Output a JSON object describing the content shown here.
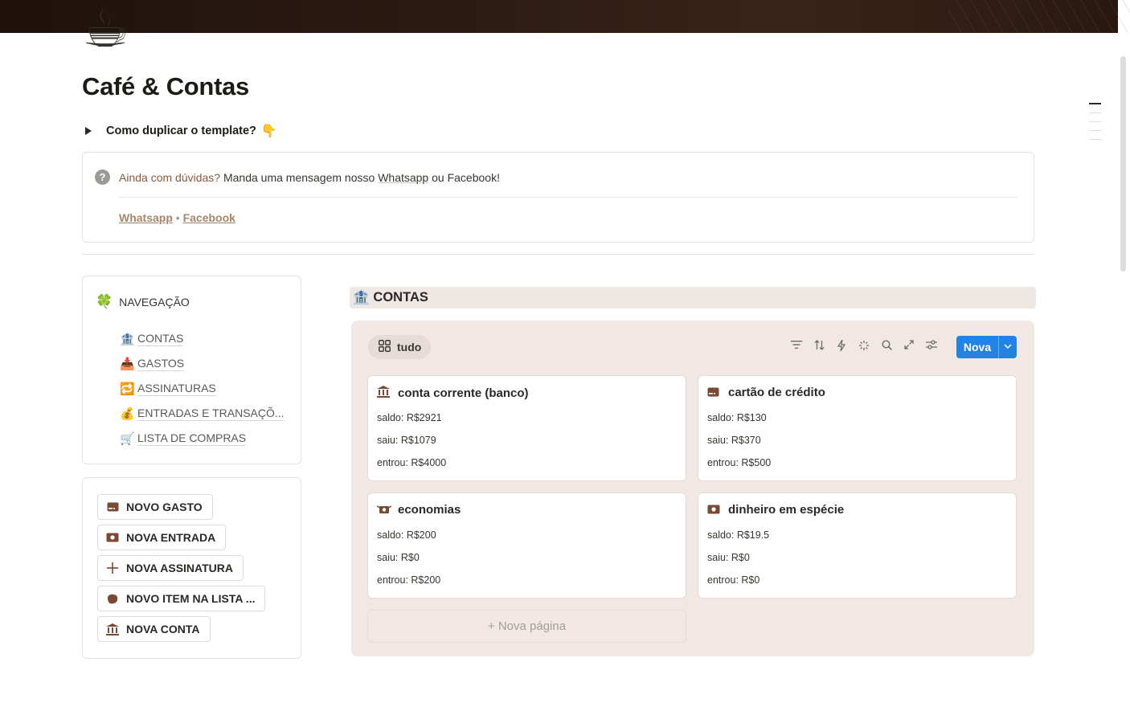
{
  "page": {
    "icon": "☕",
    "title": "Café & Contas"
  },
  "toggle": {
    "label": "Como duplicar o template?",
    "emoji": "👇"
  },
  "callout": {
    "icon": "question-icon",
    "highlight": "Ainda com dúvidas?",
    "text_middle": " Manda uma mensagem nosso ",
    "whatsapp_inline": "Whatsapp",
    "text_or": " ou Facebook!",
    "link_whatsapp": "Whatsapp",
    "separator": " • ",
    "link_facebook": "Facebook"
  },
  "navigation": {
    "icon": "🍀",
    "title": "NAVEGAÇÃO",
    "items": [
      {
        "icon": "🏦",
        "label": "CONTAS"
      },
      {
        "icon": "📥",
        "label": "GASTOS"
      },
      {
        "icon": "🔁",
        "label": "ASSINATURAS"
      },
      {
        "icon": "💰",
        "label": "ENTRADAS E TRANSAÇÕ..."
      },
      {
        "icon": "🛒",
        "label": "LISTA DE COMPRAS"
      }
    ]
  },
  "actions": [
    {
      "icon": "card-icon",
      "label": "NOVO GASTO"
    },
    {
      "icon": "cash-icon",
      "label": "NOVA ENTRADA"
    },
    {
      "icon": "plus-icon",
      "label": "NOVA ASSINATURA"
    },
    {
      "icon": "cookie-icon",
      "label": "NOVO ITEM NA LISTA ..."
    },
    {
      "icon": "bank-icon",
      "label": "NOVA CONTA"
    }
  ],
  "database": {
    "icon": "🏦",
    "title": "CONTAS",
    "view_label": "tudo",
    "new_label": "Nova",
    "new_page_label": "Nova página",
    "new_page_plus": "+",
    "cards": [
      {
        "icon": "bank-icon",
        "title": "conta corrente (banco)",
        "saldo": "saldo: R$2921",
        "saiu": "saiu: R$1079",
        "entrou": "entrou: R$4000"
      },
      {
        "icon": "card-icon",
        "title": "cartão de crédito",
        "saldo": "saldo: R$130",
        "saiu": "saiu: R$370",
        "entrou": "entrou: R$500"
      },
      {
        "icon": "money-wings-icon",
        "title": "economias",
        "saldo": "saldo: R$200",
        "saiu": "saiu: R$0",
        "entrou": "entrou: R$200"
      },
      {
        "icon": "cash-icon",
        "title": "dinheiro em espécie",
        "saldo": "saldo: R$19.5",
        "saiu": "saiu: R$0",
        "entrou": "entrou: R$0"
      }
    ]
  },
  "colors": {
    "accent_blue": "#2383e2",
    "panel_bg": "#f1e8e4",
    "brown_text": "#8a5a3c"
  }
}
